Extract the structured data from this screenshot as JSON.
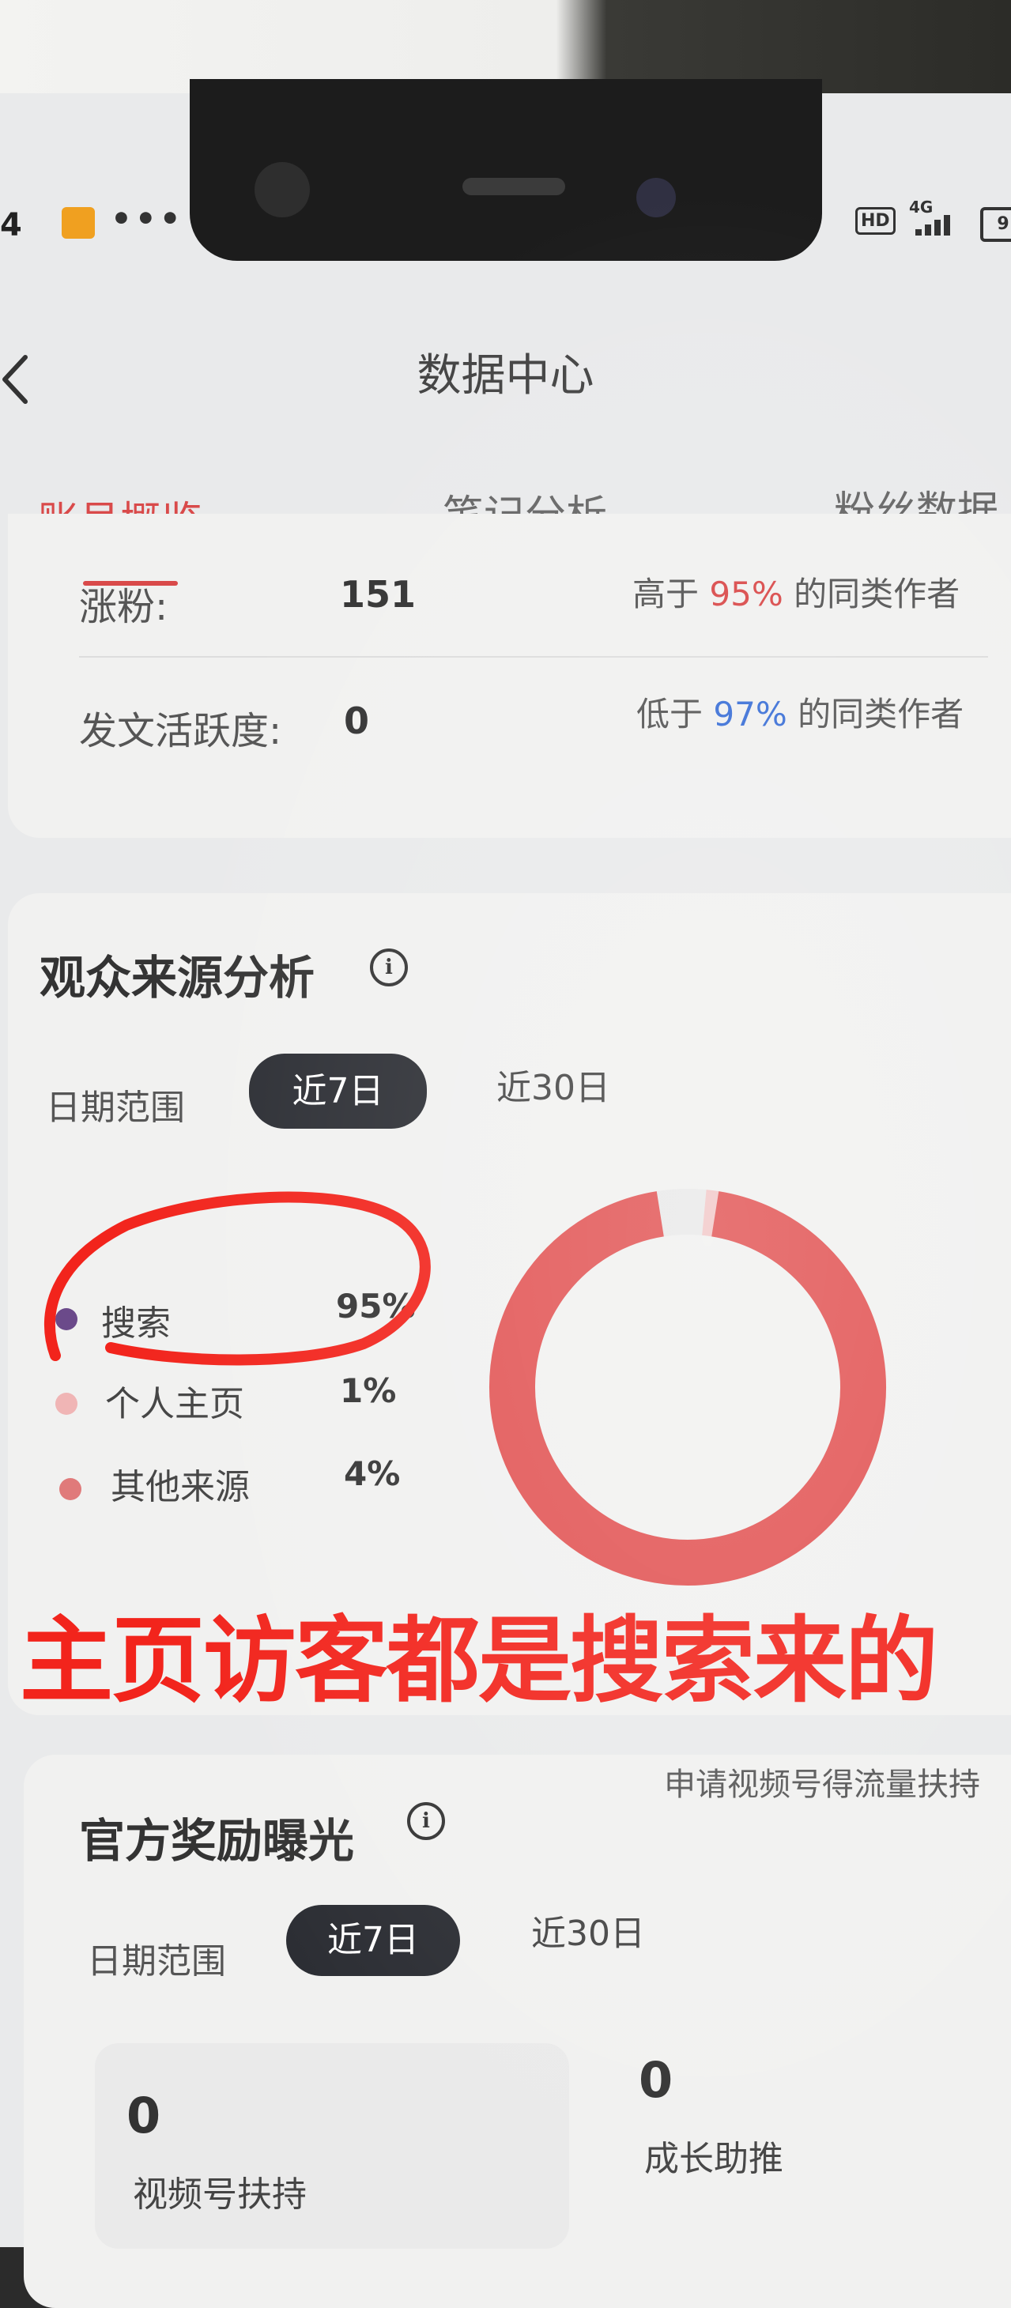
{
  "status_bar": {
    "time_fragment": "4",
    "dots": "•••",
    "hd": "HD",
    "network": "4G",
    "battery": "9"
  },
  "header": {
    "title": "数据中心"
  },
  "tabs": [
    {
      "label": "账号概览",
      "active": true
    },
    {
      "label": "笔记分析",
      "active": false
    },
    {
      "label": "粉丝数据",
      "active": false
    }
  ],
  "overview": {
    "rows": [
      {
        "label": "涨粉:",
        "value": "151",
        "compare_prefix": "高于",
        "compare_pct": "95%",
        "compare_suffix": "的同类作者"
      },
      {
        "label": "发文活跃度:",
        "value": "0",
        "compare_prefix": "低于",
        "compare_pct": "97%",
        "compare_suffix": "的同类作者"
      }
    ]
  },
  "audience": {
    "title": "观众来源分析",
    "date_label": "日期范围",
    "range_active": "近7日",
    "range_other": "近30日",
    "legend": [
      {
        "label": "搜索",
        "pct": "95%",
        "color": "#6b4a8a"
      },
      {
        "label": "个人主页",
        "pct": "1%",
        "color": "#f0b5b5"
      },
      {
        "label": "其他来源",
        "pct": "4%",
        "color": "#e07a7a"
      }
    ]
  },
  "chart_data": {
    "type": "pie",
    "categories": [
      "搜索",
      "个人主页",
      "其他来源"
    ],
    "values": [
      95,
      1,
      4
    ],
    "colors": [
      "#e25555",
      "#f2c8c8",
      "#e9e9e9"
    ],
    "style": "donut"
  },
  "annotation": {
    "text": "主页访客都是搜索来的",
    "color": "#f2241c"
  },
  "rewards": {
    "title": "官方奖励曝光",
    "apply_link": "申请视频号得流量扶持",
    "date_label": "日期范围",
    "range_active": "近7日",
    "range_other": "近30日",
    "stats": [
      {
        "value": "0",
        "label": "视频号扶持"
      },
      {
        "value": "0",
        "label": "成长助推"
      }
    ]
  }
}
